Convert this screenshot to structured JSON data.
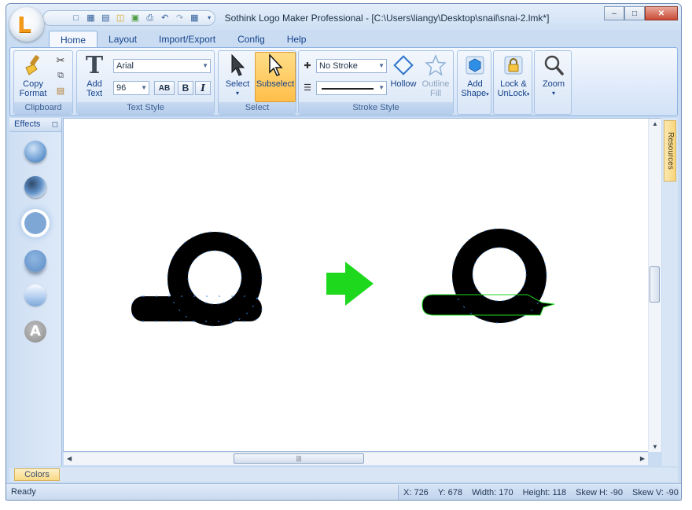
{
  "window": {
    "title": "Sothink Logo Maker Professional - [C:\\Users\\liangy\\Desktop\\snail\\snai-2.lmk*]",
    "minimize": "–",
    "maximize": "□",
    "close": "✕"
  },
  "quick_access": [
    "new-icon",
    "save-icon",
    "open-file-icon",
    "open-folder-icon",
    "export-icon",
    "print-icon",
    "undo-icon",
    "redo-icon",
    "save-as-icon",
    "customize-icon"
  ],
  "tabs": [
    {
      "label": "Home",
      "active": true
    },
    {
      "label": "Layout"
    },
    {
      "label": "Import/Export"
    },
    {
      "label": "Config"
    },
    {
      "label": "Help"
    }
  ],
  "ribbon": {
    "clipboard": {
      "label": "Clipboard",
      "copy_format_line1": "Copy",
      "copy_format_line2": "Format"
    },
    "text_style": {
      "label": "Text Style",
      "add_text_line1": "Add",
      "add_text_line2": "Text",
      "font": "Arial",
      "size": "96",
      "spacing": "AB",
      "bold": "B",
      "italic": "I"
    },
    "select": {
      "label": "Select",
      "select": "Select",
      "subselect": "Subselect"
    },
    "stroke_style": {
      "label": "Stroke Style",
      "stroke": "No Stroke",
      "hollow": "Hollow",
      "outline_fill_line1": "Outline",
      "outline_fill_line2": "Fill"
    },
    "add_shape_line1": "Add",
    "add_shape_line2": "Shape",
    "lock_line1": "Lock &",
    "lock_line2": "UnLock",
    "zoom": "Zoom"
  },
  "effects": {
    "title": "Effects"
  },
  "resources_tab": "Resources",
  "colors_tab": "Colors",
  "status": {
    "ready": "Ready",
    "x": "X: 726",
    "y": "Y: 678",
    "width": "Width: 170",
    "height": "Height: 118",
    "skew_h": "Skew H: -90",
    "skew_v": "Skew V: -90"
  },
  "colors": {
    "arrow": "#1ed81e",
    "shape": "#000000",
    "node": "#3a8cf0",
    "accent": "#ffc55c"
  }
}
